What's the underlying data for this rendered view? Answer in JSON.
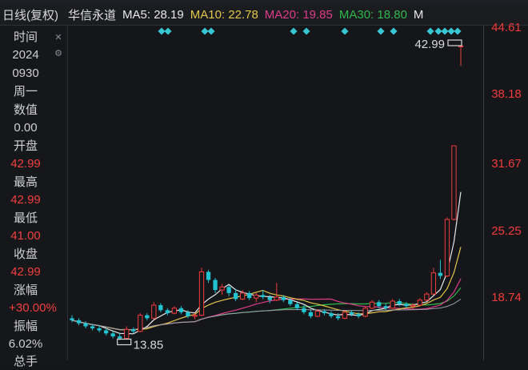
{
  "header": {
    "period": "日线(复权)",
    "stock_name": "华信永道",
    "ma5": "MA5: 28.19",
    "ma10": "MA10: 22.78",
    "ma20": "MA20: 19.85",
    "ma30": "MA30: 18.80",
    "more": "M"
  },
  "sidebar": {
    "time_label": "时间",
    "date_year": "2024",
    "date_md": "0930",
    "weekday": "周一",
    "value_label": "数值",
    "value": "0.00",
    "open_label": "开盘",
    "open": "42.99",
    "high_label": "最高",
    "high": "42.99",
    "low_label": "最低",
    "low": "41.00",
    "close_label": "收盘",
    "close": "42.99",
    "change_label": "涨幅",
    "change": "+30.00%",
    "amplitude_label": "振幅",
    "amplitude": "6.02%",
    "next_label": "总手"
  },
  "chart_data": {
    "type": "candlestick",
    "y_axis_labels": [
      "44.61",
      "38.18",
      "31.67",
      "25.25",
      "18.74"
    ],
    "ylim": [
      12.3,
      44.61
    ],
    "annotations": {
      "high_label": "42.99",
      "low_label": "13.85"
    },
    "candles": [
      [
        16.0,
        16.3,
        15.6,
        15.8
      ],
      [
        15.8,
        16.0,
        15.3,
        15.5
      ],
      [
        15.5,
        15.7,
        15.0,
        15.2
      ],
      [
        15.2,
        15.4,
        14.8,
        15.0
      ],
      [
        15.0,
        15.3,
        14.6,
        14.8
      ],
      [
        14.8,
        15.0,
        14.3,
        14.5
      ],
      [
        14.5,
        14.7,
        14.0,
        14.2
      ],
      [
        14.2,
        14.5,
        13.85,
        14.0
      ],
      [
        14.0,
        15.2,
        13.9,
        14.9
      ],
      [
        14.9,
        15.1,
        14.5,
        14.7
      ],
      [
        14.7,
        16.5,
        14.6,
        16.3
      ],
      [
        16.3,
        16.5,
        15.8,
        16.0
      ],
      [
        16.0,
        17.6,
        15.9,
        17.3
      ],
      [
        17.3,
        17.5,
        16.6,
        16.8
      ],
      [
        16.8,
        17.0,
        16.3,
        16.5
      ],
      [
        16.5,
        17.2,
        16.4,
        17.0
      ],
      [
        17.0,
        17.2,
        16.4,
        16.6
      ],
      [
        16.6,
        16.8,
        16.0,
        16.2
      ],
      [
        16.2,
        16.5,
        15.9,
        16.3
      ],
      [
        16.3,
        21.0,
        16.2,
        20.6
      ],
      [
        20.6,
        20.8,
        19.5,
        19.8
      ],
      [
        19.8,
        20.0,
        18.5,
        18.8
      ],
      [
        18.8,
        19.4,
        18.3,
        19.1
      ],
      [
        19.1,
        19.3,
        18.2,
        18.5
      ],
      [
        18.5,
        18.9,
        17.7,
        17.9
      ],
      [
        17.9,
        18.8,
        17.8,
        18.5
      ],
      [
        18.5,
        18.7,
        17.8,
        18.0
      ],
      [
        18.0,
        18.5,
        17.6,
        18.3
      ],
      [
        18.3,
        18.8,
        17.9,
        18.1
      ],
      [
        18.1,
        18.3,
        17.5,
        17.8
      ],
      [
        17.8,
        19.5,
        17.7,
        18.1
      ],
      [
        18.1,
        18.3,
        17.6,
        17.8
      ],
      [
        17.8,
        18.0,
        17.2,
        17.4
      ],
      [
        17.4,
        17.6,
        16.8,
        17.0
      ],
      [
        17.0,
        17.3,
        16.4,
        16.6
      ],
      [
        16.6,
        16.8,
        16.0,
        16.2
      ],
      [
        16.2,
        16.9,
        16.1,
        16.7
      ],
      [
        16.7,
        16.9,
        16.3,
        16.5
      ],
      [
        16.5,
        16.7,
        16.0,
        16.2
      ],
      [
        16.2,
        16.5,
        15.8,
        16.0
      ],
      [
        16.0,
        16.8,
        15.9,
        16.6
      ],
      [
        16.6,
        16.8,
        16.2,
        16.4
      ],
      [
        16.4,
        16.6,
        16.0,
        16.2
      ],
      [
        16.2,
        17.2,
        16.1,
        17.0
      ],
      [
        17.0,
        17.8,
        16.9,
        17.6
      ],
      [
        17.6,
        17.8,
        17.0,
        17.2
      ],
      [
        17.2,
        17.5,
        16.8,
        17.0
      ],
      [
        17.0,
        17.9,
        16.9,
        17.7
      ],
      [
        17.7,
        17.9,
        17.2,
        17.4
      ],
      [
        17.4,
        17.6,
        17.0,
        17.2
      ],
      [
        17.2,
        17.5,
        16.9,
        17.3
      ],
      [
        17.3,
        18.0,
        17.2,
        17.8
      ],
      [
        17.8,
        18.6,
        17.7,
        18.4
      ],
      [
        18.4,
        21.0,
        18.3,
        20.5
      ],
      [
        20.5,
        21.8,
        19.9,
        20.2
      ],
      [
        20.2,
        26.0,
        20.1,
        25.8
      ],
      [
        25.8,
        33.1,
        25.7,
        33.1
      ],
      [
        42.99,
        42.99,
        41.0,
        42.99
      ]
    ]
  }
}
